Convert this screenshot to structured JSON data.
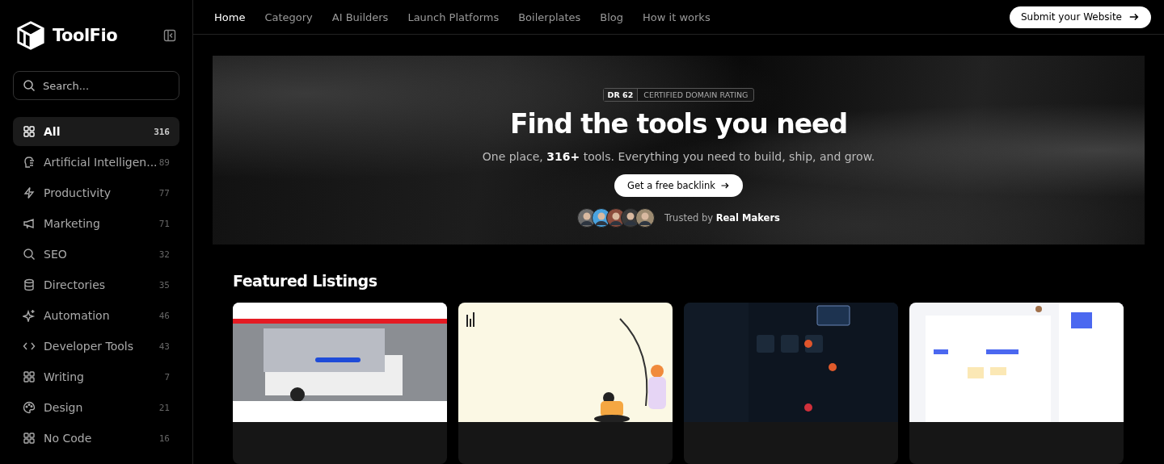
{
  "brand": {
    "name": "ToolFio"
  },
  "search": {
    "placeholder": "Search..."
  },
  "categories": [
    {
      "label": "All",
      "count": "316",
      "selected": true
    },
    {
      "label": "Artificial Intelligen...",
      "count": "89",
      "selected": false
    },
    {
      "label": "Productivity",
      "count": "77",
      "selected": false
    },
    {
      "label": "Marketing",
      "count": "71",
      "selected": false
    },
    {
      "label": "SEO",
      "count": "32",
      "selected": false
    },
    {
      "label": "Directories",
      "count": "35",
      "selected": false
    },
    {
      "label": "Automation",
      "count": "46",
      "selected": false
    },
    {
      "label": "Developer Tools",
      "count": "43",
      "selected": false
    },
    {
      "label": "Writing",
      "count": "7",
      "selected": false
    },
    {
      "label": "Design",
      "count": "21",
      "selected": false
    },
    {
      "label": "No Code",
      "count": "16",
      "selected": false
    }
  ],
  "nav": [
    {
      "label": "Home",
      "selected": true
    },
    {
      "label": "Category",
      "selected": false
    },
    {
      "label": "AI Builders",
      "selected": false
    },
    {
      "label": "Launch Platforms",
      "selected": false
    },
    {
      "label": "Boilerplates",
      "selected": false
    },
    {
      "label": "Blog",
      "selected": false
    },
    {
      "label": "How it works",
      "selected": false
    }
  ],
  "submit_button": "Submit your Website",
  "hero": {
    "badge_key": "DR 62",
    "badge_text": "CERTIFIED DOMAIN RATING",
    "title": "Find the tools you need",
    "subtitle": "One place, **316+** tools. Everything you need to build, ship, and grow.",
    "cta": "Get a free backlink",
    "trusted": "Trusted by **Real Makers**"
  },
  "featured": {
    "title": "Featured Listings"
  }
}
